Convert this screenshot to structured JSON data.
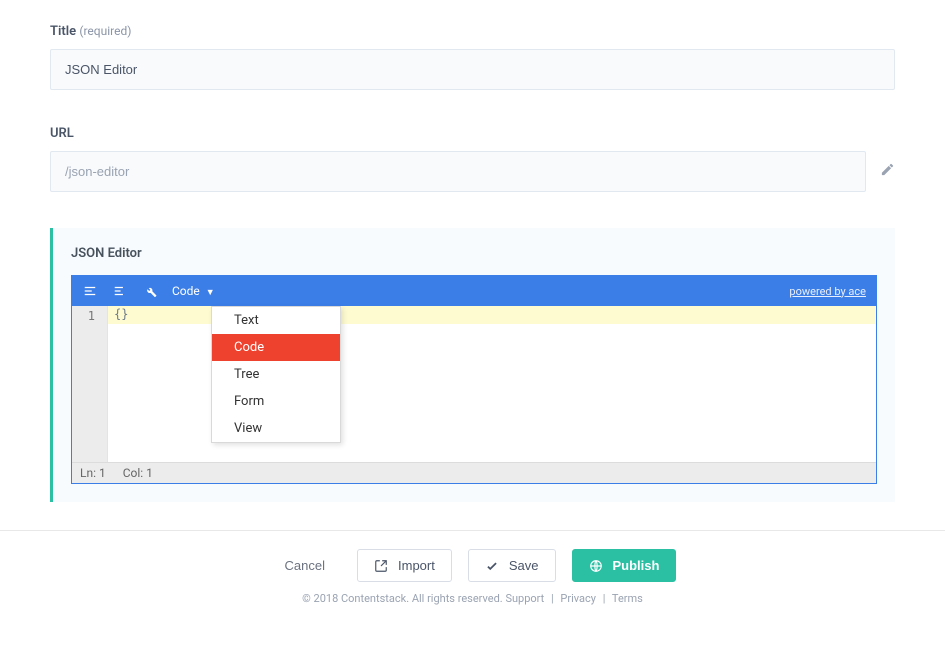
{
  "form": {
    "title_label": "Title",
    "title_required": "(required)",
    "title_value": "JSON Editor",
    "url_label": "URL",
    "url_value": "/json-editor"
  },
  "panel": {
    "title": "JSON Editor"
  },
  "editor": {
    "mode_label": "Code",
    "powered_label": "powered by ace",
    "gutter_line": "1",
    "code_content": "{}",
    "dropdown": {
      "items": [
        "Text",
        "Code",
        "Tree",
        "Form",
        "View"
      ],
      "selected": "Code"
    },
    "status": {
      "ln": "Ln: 1",
      "col": "Col: 1"
    }
  },
  "actions": {
    "cancel": "Cancel",
    "import": "Import",
    "save": "Save",
    "publish": "Publish"
  },
  "footer": {
    "copyright": "© 2018 Contentstack. All rights reserved.",
    "support": "Support",
    "privacy": "Privacy",
    "terms": "Terms"
  }
}
